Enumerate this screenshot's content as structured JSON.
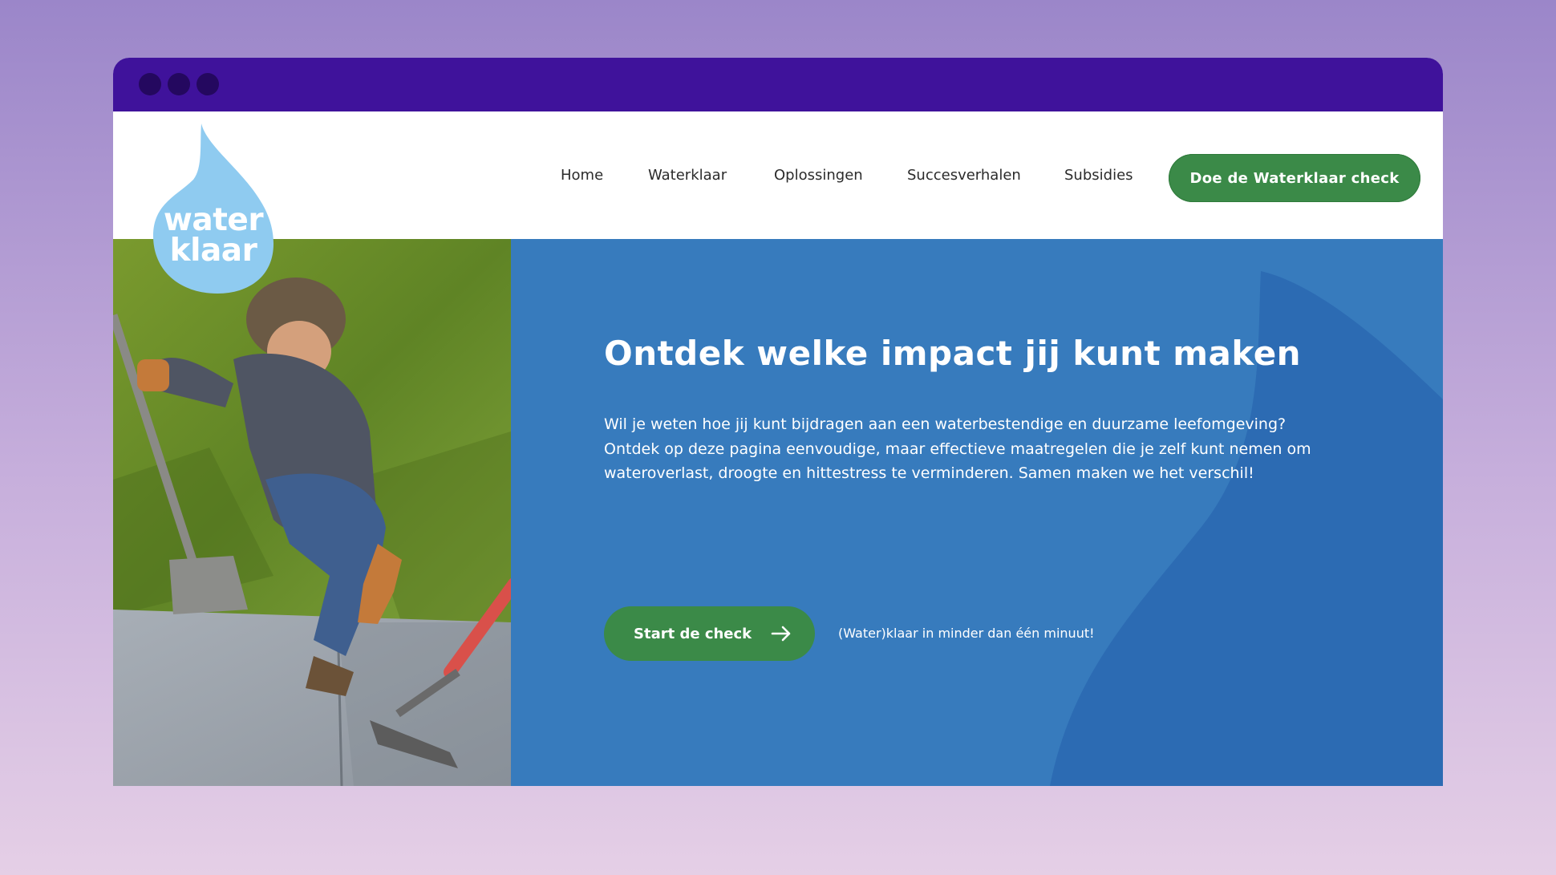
{
  "browser": {
    "dots": [
      "close",
      "minimize",
      "maximize"
    ]
  },
  "brand": {
    "logo_line1": "water",
    "logo_line2": "klaar",
    "logo_color": "#8fcbf0"
  },
  "nav": {
    "items": [
      {
        "label": "Home"
      },
      {
        "label": "Waterklaar"
      },
      {
        "label": "Oplossingen"
      },
      {
        "label": "Succesverhalen"
      },
      {
        "label": "Subsidies"
      }
    ],
    "cta_label": "Doe de Waterklaar check"
  },
  "hero": {
    "title": "Ontdek welke impact jij kunt maken",
    "body": "Wil je weten hoe jij kunt bijdragen aan een waterbestendige en duurzame leefomgeving? Ontdek op deze pagina eenvoudige, maar effectieve maatregelen die je zelf kunt nemen om wateroverlast, droogte en hittestress te verminderen. Samen maken we het verschil!",
    "start_label": "Start de check",
    "hint": "(Water)klaar in minder dan één minuut!"
  },
  "colors": {
    "titlebar": "#3f129b",
    "hero_bg": "#377bbd",
    "hero_shape": "#2c6bb3",
    "button_green": "#3b8a48"
  }
}
